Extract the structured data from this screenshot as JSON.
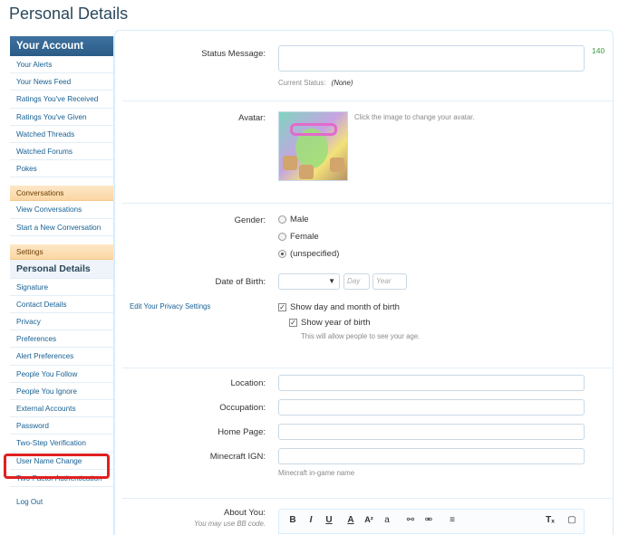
{
  "page": {
    "title": "Personal Details"
  },
  "sidebar": {
    "header": "Your Account",
    "account_items": [
      "Your Alerts",
      "Your News Feed",
      "Ratings You've Received",
      "Ratings You've Given",
      "Watched Threads",
      "Watched Forums",
      "Pokes"
    ],
    "conversations_header": "Conversations",
    "conversation_items": [
      "View Conversations",
      "Start a New Conversation"
    ],
    "settings_header": "Settings",
    "active_item": "Personal Details",
    "settings_items": [
      "Signature",
      "Contact Details",
      "Privacy",
      "Preferences",
      "Alert Preferences",
      "People You Follow",
      "People You Ignore",
      "External Accounts",
      "Password",
      "Two-Step Verification",
      "User Name Change",
      "Two-Factor Authentication"
    ],
    "logout": "Log Out"
  },
  "form": {
    "status_label": "Status Message:",
    "status_counter": "140",
    "current_status_label": "Current Status:",
    "current_status_value": "(None)",
    "avatar_label": "Avatar:",
    "avatar_hint": "Click the image to change your avatar.",
    "gender_label": "Gender:",
    "gender_options": [
      "Male",
      "Female",
      "(unspecified)"
    ],
    "gender_selected": "(unspecified)",
    "dob_label": "Date of Birth:",
    "dob_day_placeholder": "Day",
    "dob_year_placeholder": "Year",
    "privacy_link": "Edit Your Privacy Settings",
    "show_day_month": "Show day and month of birth",
    "show_year": "Show year of birth",
    "age_hint": "This will allow people to see your age.",
    "location_label": "Location:",
    "occupation_label": "Occupation:",
    "homepage_label": "Home Page:",
    "minecraft_label": "Minecraft IGN:",
    "minecraft_hint": "Minecraft in-game name",
    "about_label": "About You:",
    "about_hint": "You may use BB code."
  },
  "toolbar": {
    "bold": "B",
    "italic": "I",
    "underline": "U",
    "font_color": "A",
    "font_size": "A²",
    "font_family": "a",
    "link": "⚯",
    "unlink": "⚮",
    "align": "≡",
    "remove_format": "Tₓ",
    "template": "▢"
  },
  "colors": {
    "accent": "#2b5c87",
    "link": "#176093",
    "highlight_box": "#e02020",
    "counter": "#3b9e3b"
  }
}
